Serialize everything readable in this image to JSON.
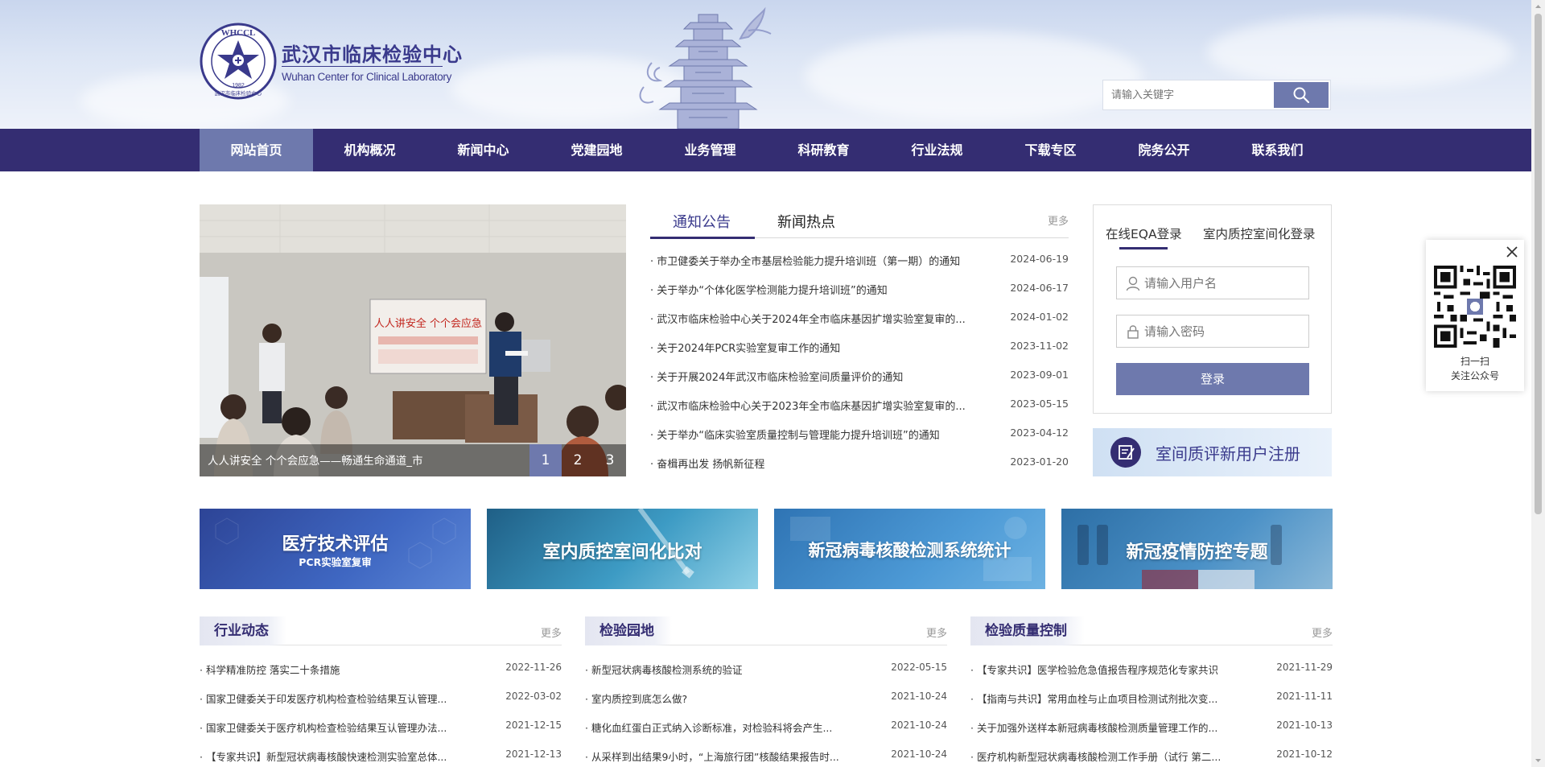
{
  "site": {
    "name_cn": "武汉市临床检验中心",
    "name_en": "Wuhan Center for Clinical Laboratory",
    "seal_text_top": "WHCCL",
    "seal_year": "1982",
    "seal_text_bottom": "武汉市临床检验中心"
  },
  "search": {
    "placeholder": "请输入关键字",
    "icon": "search-icon"
  },
  "nav": {
    "items": [
      {
        "label": "网站首页"
      },
      {
        "label": "机构概况"
      },
      {
        "label": "新闻中心"
      },
      {
        "label": "党建园地"
      },
      {
        "label": "业务管理"
      },
      {
        "label": "科研教育"
      },
      {
        "label": "行业法规"
      },
      {
        "label": "下载专区"
      },
      {
        "label": "院务公开"
      },
      {
        "label": "联系我们"
      }
    ],
    "active_index": 0
  },
  "slider": {
    "caption": "人人讲安全 个个会应急——畅通生命通道_市",
    "photo_text": "人人讲安全 个个会应急",
    "dots": [
      "1",
      "2",
      "3"
    ],
    "active_dot": 0
  },
  "notices": {
    "tabs": [
      {
        "label": "通知公告"
      },
      {
        "label": "新闻热点"
      }
    ],
    "active_tab": 0,
    "more": "更多",
    "items": [
      {
        "title": "· 市卫健委关于举办全市基层检验能力提升培训班（第一期）的通知",
        "date": "2024-06-19"
      },
      {
        "title": "· 关于举办“个体化医学检测能力提升培训班”的通知",
        "date": "2024-06-17"
      },
      {
        "title": "· 武汉市临床检验中心关于2024年全市临床基因扩增实验室复审的...",
        "date": "2024-01-02"
      },
      {
        "title": "· 关于2024年PCR实验室复审工作的通知",
        "date": "2023-11-02"
      },
      {
        "title": "· 关于开展2024年武汉市临床检验室间质量评价的通知",
        "date": "2023-09-01"
      },
      {
        "title": "· 武汉市临床检验中心关于2023年全市临床基因扩增实验室复审的...",
        "date": "2023-05-15"
      },
      {
        "title": "· 关于举办“临床实验室质量控制与管理能力提升培训班”的通知",
        "date": "2023-04-12"
      },
      {
        "title": "· 奋楫再出发 扬帆新征程",
        "date": "2023-01-20"
      }
    ]
  },
  "login": {
    "tabs": [
      {
        "label": "在线EQA登录"
      },
      {
        "label": "室内质控室间化登录"
      }
    ],
    "active_tab": 0,
    "username_placeholder": "请输入用户名",
    "password_placeholder": "请输入密码",
    "submit": "登录"
  },
  "register": {
    "label": "室间质评新用户注册",
    "icon": "edit-icon"
  },
  "qr": {
    "line1": "扫一扫",
    "line2": "关注公众号",
    "close_icon": "close-icon"
  },
  "banners": [
    {
      "title": "医疗技术评估",
      "subtitle": "PCR实验室复审",
      "color": "#2f4aa0"
    },
    {
      "title": "室内质控室间化比对",
      "subtitle": "",
      "color": "#2a7fa8"
    },
    {
      "title": "新冠病毒核酸检测系统统计",
      "subtitle": "",
      "color": "#3a86c4"
    },
    {
      "title": "新冠疫情防控专题",
      "subtitle": "",
      "color": "#3d84b8"
    }
  ],
  "columns": [
    {
      "title": "行业动态",
      "more": "更多",
      "items": [
        {
          "title": "· 科学精准防控 落实二十条措施",
          "date": "2022-11-26"
        },
        {
          "title": "· 国家卫健委关于印发医疗机构检查检验结果互认管理...",
          "date": "2022-03-02"
        },
        {
          "title": "· 国家卫健委关于医疗机构检查检验结果互认管理办法...",
          "date": "2021-12-15"
        },
        {
          "title": "· 【专家共识】新型冠状病毒核酸快速检测实验室总体...",
          "date": "2021-12-13"
        }
      ]
    },
    {
      "title": "检验园地",
      "more": "更多",
      "items": [
        {
          "title": "· 新型冠状病毒核酸检测系统的验证",
          "date": "2022-05-15"
        },
        {
          "title": "· 室内质控到底怎么做?",
          "date": "2021-10-24"
        },
        {
          "title": "· 糖化血红蛋白正式纳入诊断标准，对检验科将会产生...",
          "date": "2021-10-24"
        },
        {
          "title": "· 从采样到出结果9小时，“上海旅行团”核酸结果报告时...",
          "date": "2021-10-24"
        }
      ]
    },
    {
      "title": "检验质量控制",
      "more": "更多",
      "items": [
        {
          "title": "· 【专家共识】医学检验危急值报告程序规范化专家共识",
          "date": "2021-11-29"
        },
        {
          "title": "· 【指南与共识】常用血栓与止血项目检测试剂批次变...",
          "date": "2021-11-11"
        },
        {
          "title": "· 关于加强外送样本新冠病毒核酸检测质量管理工作的...",
          "date": "2021-10-13"
        },
        {
          "title": "· 医疗机构新型冠状病毒核酸检测工作手册（试行 第二...",
          "date": "2021-10-12"
        }
      ]
    }
  ],
  "colors": {
    "nav_bg": "#342d72",
    "accent": "#6e79ad",
    "brand_text": "#3a3a8c"
  }
}
